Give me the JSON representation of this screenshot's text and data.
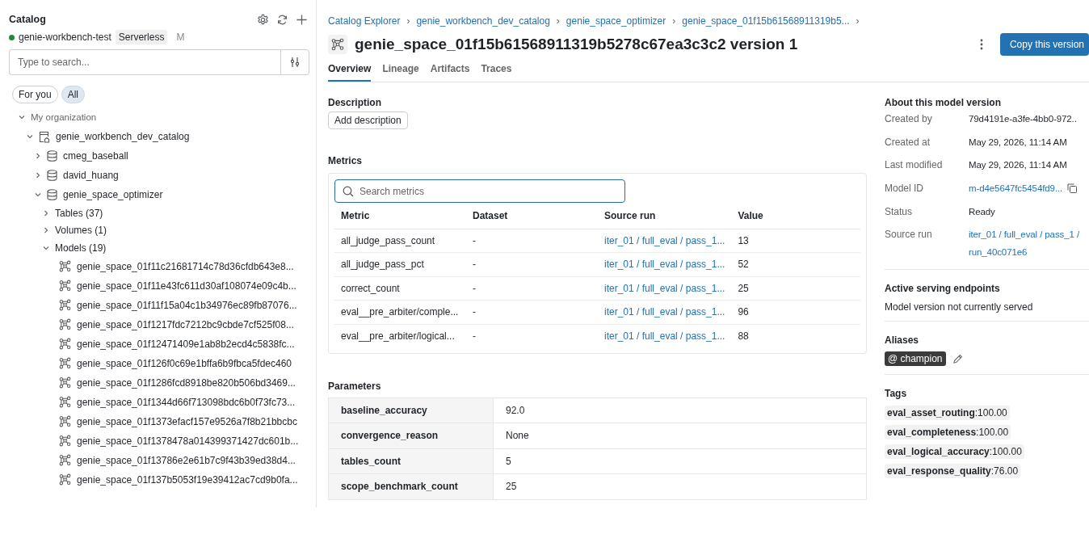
{
  "sidebar": {
    "title": "Catalog",
    "workspace": "genie-workbench-test",
    "compute": "Serverless",
    "compute_extra": "M",
    "search": {
      "placeholder": "Type to search..."
    },
    "filters": [
      {
        "label": "For you",
        "selected": false
      },
      {
        "label": "All",
        "selected": true
      }
    ],
    "tree": [
      {
        "label": "My organization",
        "kind": "group",
        "expanded": true,
        "children": [
          {
            "label": "genie_workbench_dev_catalog",
            "kind": "catalog",
            "expanded": true,
            "children": [
              {
                "label": "cmeg_baseball",
                "kind": "schema",
                "expanded": false
              },
              {
                "label": "david_huang",
                "kind": "schema",
                "expanded": false
              },
              {
                "label": "genie_space_optimizer",
                "kind": "schema",
                "expanded": true,
                "children": [
                  {
                    "label": "Tables (37)",
                    "kind": "folder",
                    "expanded": false
                  },
                  {
                    "label": "Volumes (1)",
                    "kind": "folder",
                    "expanded": false
                  },
                  {
                    "label": "Models (19)",
                    "kind": "folder",
                    "expanded": true,
                    "children": [
                      {
                        "label": "genie_space_01f11c21681714c78d36cfdb643e8...",
                        "kind": "model"
                      },
                      {
                        "label": "genie_space_01f11e43fc611d30af108074e09c4b...",
                        "kind": "model"
                      },
                      {
                        "label": "genie_space_01f11f15a04c1b34976ec89fb87076...",
                        "kind": "model"
                      },
                      {
                        "label": "genie_space_01f1217fdc7212bc9cbde7cf525f08...",
                        "kind": "model"
                      },
                      {
                        "label": "genie_space_01f12471409e1ab8b2ecd4c5838fc...",
                        "kind": "model"
                      },
                      {
                        "label": "genie_space_01f126f0c69e1bffa6b9fbca5fdec460",
                        "kind": "model"
                      },
                      {
                        "label": "genie_space_01f1286fcd8918be820b506bd3469...",
                        "kind": "model"
                      },
                      {
                        "label": "genie_space_01f1344d66f713098bdc6b0f73fc73...",
                        "kind": "model"
                      },
                      {
                        "label": "genie_space_01f1373efacf157e9526a7f8b21bbcbc",
                        "kind": "model"
                      },
                      {
                        "label": "genie_space_01f1378478a014399371427dc601b...",
                        "kind": "model"
                      },
                      {
                        "label": "genie_space_01f13786e2e61b7c9f43b39ed38d4...",
                        "kind": "model"
                      },
                      {
                        "label": "genie_space_01f137b5053f19e39412ac7cd9b0fa...",
                        "kind": "model"
                      }
                    ]
                  }
                ]
              }
            ]
          }
        ]
      }
    ]
  },
  "breadcrumbs": {
    "separator": "›",
    "items": [
      "Catalog Explorer",
      "genie_workbench_dev_catalog",
      "genie_space_optimizer",
      "genie_space_01f15b61568911319b5..."
    ]
  },
  "title": "genie_space_01f15b61568911319b5278c67ea3c3c2 version 1",
  "primary_button": "Copy this version",
  "tabs": [
    {
      "label": "Overview",
      "selected": true
    },
    {
      "label": "Lineage",
      "selected": false
    },
    {
      "label": "Artifacts",
      "selected": false
    },
    {
      "label": "Traces",
      "selected": false
    }
  ],
  "description": {
    "heading": "Description",
    "button": "Add description"
  },
  "metrics": {
    "heading": "Metrics",
    "search": {
      "placeholder": "Search metrics"
    },
    "columns": [
      "Metric",
      "Dataset",
      "Source run",
      "Value"
    ],
    "rows": [
      {
        "metric": "all_judge_pass_count",
        "dataset": "-",
        "source_run": "iter_01 / full_eval / pass_1...",
        "value": "13"
      },
      {
        "metric": "all_judge_pass_pct",
        "dataset": "-",
        "source_run": "iter_01 / full_eval / pass_1...",
        "value": "52"
      },
      {
        "metric": "correct_count",
        "dataset": "-",
        "source_run": "iter_01 / full_eval / pass_1...",
        "value": "25"
      },
      {
        "metric": "eval__pre_arbiter/comple...",
        "dataset": "-",
        "source_run": "iter_01 / full_eval / pass_1...",
        "value": "96"
      },
      {
        "metric": "eval__pre_arbiter/logical...",
        "dataset": "-",
        "source_run": "iter_01 / full_eval / pass_1...",
        "value": "88"
      }
    ]
  },
  "parameters": {
    "heading": "Parameters",
    "rows": [
      {
        "name": "baseline_accuracy",
        "value": "92.0"
      },
      {
        "name": "convergence_reason",
        "value": "None"
      },
      {
        "name": "tables_count",
        "value": "5"
      },
      {
        "name": "scope_benchmark_count",
        "value": "25"
      }
    ]
  },
  "about": {
    "heading": "About this model version",
    "fields": [
      {
        "label": "Created by",
        "value": "79d4191e-a3fe-4bb0-972..",
        "kind": "text"
      },
      {
        "label": "Created at",
        "value": "May 29, 2026, 11:14 AM",
        "kind": "text"
      },
      {
        "label": "Last modified",
        "value": "May 29, 2026, 11:14 AM",
        "kind": "text"
      },
      {
        "label": "Model ID",
        "value": "m-d4e5647fc5454fd9...",
        "kind": "copy_link"
      },
      {
        "label": "Status",
        "value": "Ready",
        "kind": "text"
      },
      {
        "label": "Source run",
        "value": "iter_01 / full_eval / pass_1 / run_40c071e6",
        "kind": "link"
      }
    ]
  },
  "serving": {
    "heading": "Active serving endpoints",
    "text": "Model version not currently served"
  },
  "aliases": {
    "heading": "Aliases",
    "items": [
      "@ champion"
    ]
  },
  "tags": {
    "heading": "Tags",
    "items": [
      "**eval_asset_routing**:100.00",
      "**eval_completeness**:100.00",
      "**eval_logical_accuracy**:100.00",
      "**eval_response_quality**:76.00"
    ]
  }
}
